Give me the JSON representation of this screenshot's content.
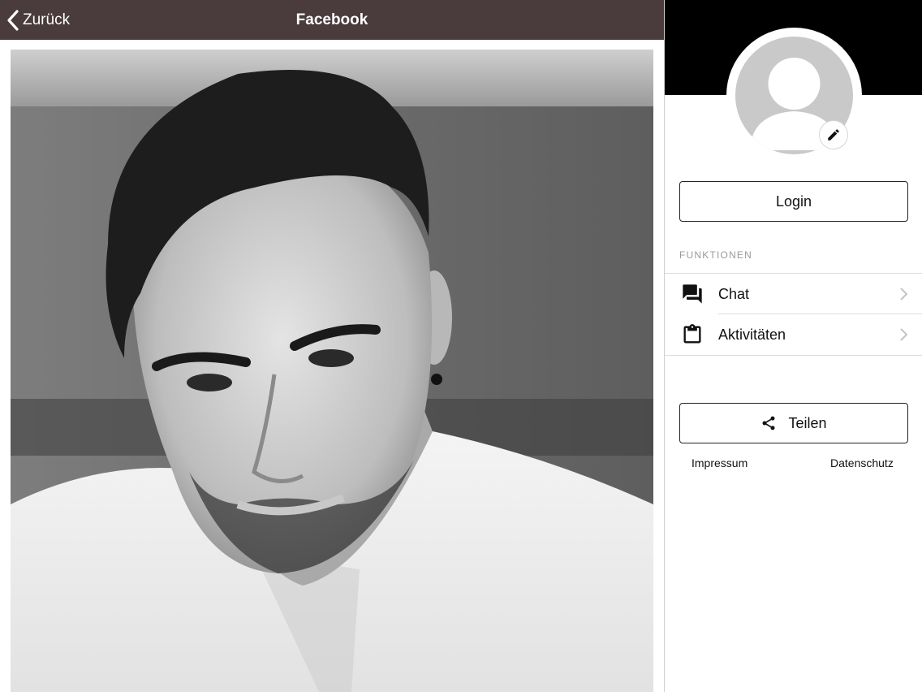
{
  "header": {
    "back_label": "Zurück",
    "title": "Facebook"
  },
  "colors": {
    "topbar": "#4a3b3d",
    "cover": "#000000",
    "avatar_placeholder": "#c9c9c9"
  },
  "sidebar": {
    "login_label": "Login",
    "section_label": "FUNKTIONEN",
    "items": [
      {
        "label": "Chat",
        "icon": "chat-icon"
      },
      {
        "label": "Aktivitäten",
        "icon": "clipboard-icon"
      }
    ],
    "share_label": "Teilen",
    "impressum_label": "Impressum",
    "datenschutz_label": "Datenschutz"
  }
}
